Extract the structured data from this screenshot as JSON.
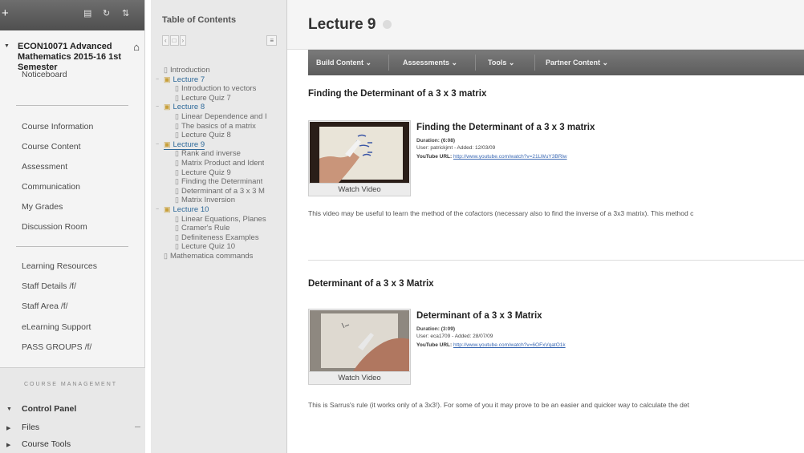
{
  "sidebar": {
    "course_title": "ECON10071 Advanced Mathematics 2015-16 1st Semester",
    "links_group1": [
      "Noticeboard"
    ],
    "links_group2": [
      "Course Information",
      "Course Content",
      "Assessment",
      "Communication",
      "My Grades",
      "Discussion Room"
    ],
    "links_group3": [
      "Learning Resources",
      "Staff Details /f/",
      "Staff Area /f/",
      "eLearning Support",
      "PASS GROUPS /f/"
    ],
    "management": {
      "header": "COURSE MANAGEMENT",
      "control_panel": "Control Panel",
      "files": "Files",
      "course_tools": "Course Tools"
    }
  },
  "toc": {
    "title": "Table of Contents",
    "items": [
      {
        "label": "Introduction",
        "type": "page"
      },
      {
        "label": "Lecture 7",
        "type": "folder"
      },
      {
        "label": "Introduction to vectors",
        "type": "page"
      },
      {
        "label": "Lecture Quiz 7",
        "type": "page"
      },
      {
        "label": "Lecture 8",
        "type": "folder"
      },
      {
        "label": "Linear Dependence and I",
        "type": "page"
      },
      {
        "label": "The basics of a matrix",
        "type": "page"
      },
      {
        "label": "Lecture Quiz 8",
        "type": "page"
      },
      {
        "label": "Lecture 9",
        "type": "folder"
      },
      {
        "label": "Rank and inverse",
        "type": "page"
      },
      {
        "label": "Matrix Product and Ident",
        "type": "page"
      },
      {
        "label": "Lecture Quiz 9",
        "type": "page"
      },
      {
        "label": "Finding the Determinant",
        "type": "page"
      },
      {
        "label": "Determinant of a 3 x 3 M",
        "type": "page"
      },
      {
        "label": "Matrix Inversion",
        "type": "page"
      },
      {
        "label": "Lecture 10",
        "type": "folder"
      },
      {
        "label": "Linear Equations, Planes",
        "type": "page"
      },
      {
        "label": "Cramer's Rule",
        "type": "page"
      },
      {
        "label": "Definiteness Examples",
        "type": "page"
      },
      {
        "label": "Lecture Quiz 10",
        "type": "page"
      },
      {
        "label": "Mathematica commands",
        "type": "page"
      }
    ]
  },
  "main": {
    "title": "Lecture 9",
    "actions": [
      "Build Content",
      "Assessments",
      "Tools",
      "Partner Content"
    ],
    "items": [
      {
        "heading": "Finding the Determinant of a 3 x 3 matrix",
        "video_title": "Finding the Determinant of a 3 x 3 matrix",
        "duration_label": "Duration:",
        "duration": "(6:08)",
        "user_line": "User: patrickjmt - Added: 12/03/09",
        "url_label": "YouTube URL:",
        "url": "http://www.youtube.com/watch?v=21LWuY3BRlw",
        "watch_label": "Watch Video",
        "description": "This video may be useful to learn the method of the cofactors (necessary also to find the inverse of a 3x3 matrix). This method c"
      },
      {
        "heading": "Determinant of a 3 x 3 Matrix",
        "video_title": "Determinant of a 3 x 3 Matrix",
        "duration_label": "Duration:",
        "duration": "(3:09)",
        "user_line": "User: eca1709 - Added: 28/07/09",
        "url_label": "YouTube URL:",
        "url": "http://www.youtube.com/watch?v=6OFxVqatO1k",
        "watch_label": "Watch Video",
        "description": "This is Sarrus's rule (it works only of a 3x3!). For some of you it may prove to be an easier and quicker way to calculate the det"
      }
    ]
  }
}
